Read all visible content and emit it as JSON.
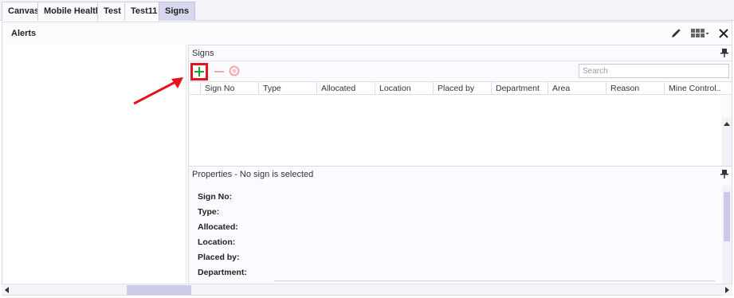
{
  "tabs": [
    {
      "label": "Canvas",
      "active": false
    },
    {
      "label": "Mobile Health",
      "active": false
    },
    {
      "label": "Test",
      "active": false
    },
    {
      "label": "Test11",
      "active": false
    },
    {
      "label": "Signs",
      "active": true
    }
  ],
  "alerts": {
    "title": "Alerts",
    "toolbar": {
      "edit_icon": "pencil-icon",
      "layout_icon": "grid-layout-icon",
      "close_icon": "close-icon"
    }
  },
  "signs": {
    "title": "Signs",
    "toolbar": {
      "add_icon": "plus-icon",
      "remove_icon": "minus-icon",
      "clear_icon": "circle-icon"
    },
    "search": {
      "placeholder": "Search",
      "value": ""
    },
    "columns": [
      "Sign No",
      "Type",
      "Allocated",
      "Location",
      "Placed by",
      "Department",
      "Area",
      "Reason",
      "Mine Control..."
    ],
    "rows": []
  },
  "properties": {
    "title": "Properties - No sign is selected",
    "fields": [
      "Sign No:",
      "Type:",
      "Allocated:",
      "Location:",
      "Placed by:",
      "Department:"
    ]
  },
  "colors": {
    "accent": "#e3141c",
    "add_green": "#1aa33a",
    "active_tab": "#d7d7ee"
  }
}
